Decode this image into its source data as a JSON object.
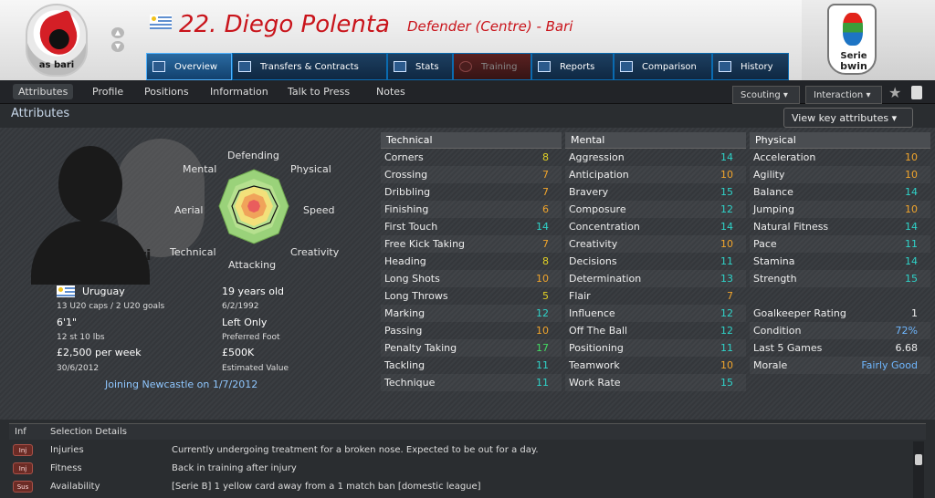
{
  "header": {
    "club_logo_text": "as bari",
    "player_name": "22. Diego Polenta",
    "position": "Defender (Centre) - Bari",
    "league_logo_l1": "Serie",
    "league_logo_l2": "bwin"
  },
  "tabs": [
    {
      "label": "Overview"
    },
    {
      "label": "Transfers & Contracts"
    },
    {
      "label": "Stats"
    },
    {
      "label": "Training"
    },
    {
      "label": "Reports"
    },
    {
      "label": "Comparison"
    },
    {
      "label": "History"
    }
  ],
  "subnav": {
    "items": [
      "Attributes",
      "Profile",
      "Positions",
      "Information",
      "Talk to Press",
      "Notes"
    ],
    "scouting": "Scouting",
    "interaction": "Interaction"
  },
  "section": {
    "title": "Attributes",
    "view_key": "View key attributes"
  },
  "radar_labels": {
    "defending": "Defending",
    "physical": "Physical",
    "speed": "Speed",
    "creativity": "Creativity",
    "attacking": "Attacking",
    "technical": "Technical",
    "aerial": "Aerial",
    "mental": "Mental"
  },
  "profile": {
    "nation": "Uruguay",
    "caps": "13 U20 caps / 2 U20 goals",
    "height": "6'1\"",
    "weight": "12 st 10 lbs",
    "wage": "£2,500 per week",
    "contract": "30/6/2012",
    "age": "19 years old",
    "dob": "6/2/1992",
    "foot": "Left Only",
    "foot_label": "Preferred Foot",
    "value": "£500K",
    "value_label": "Estimated Value",
    "joining": "Joining Newcastle on 1/7/2012"
  },
  "technical": {
    "title": "Technical",
    "rows": [
      {
        "name": "Corners",
        "val": "8",
        "c": "c-y"
      },
      {
        "name": "Crossing",
        "val": "7",
        "c": "c-o"
      },
      {
        "name": "Dribbling",
        "val": "7",
        "c": "c-o"
      },
      {
        "name": "Finishing",
        "val": "6",
        "c": "c-o"
      },
      {
        "name": "First Touch",
        "val": "14",
        "c": "c-t"
      },
      {
        "name": "Free Kick Taking",
        "val": "7",
        "c": "c-o"
      },
      {
        "name": "Heading",
        "val": "8",
        "c": "c-y"
      },
      {
        "name": "Long Shots",
        "val": "10",
        "c": "c-o"
      },
      {
        "name": "Long Throws",
        "val": "5",
        "c": "c-y"
      },
      {
        "name": "Marking",
        "val": "12",
        "c": "c-t"
      },
      {
        "name": "Passing",
        "val": "10",
        "c": "c-o"
      },
      {
        "name": "Penalty Taking",
        "val": "17",
        "c": "c-g"
      },
      {
        "name": "Tackling",
        "val": "11",
        "c": "c-t"
      },
      {
        "name": "Technique",
        "val": "11",
        "c": "c-t"
      }
    ]
  },
  "mental": {
    "title": "Mental",
    "rows": [
      {
        "name": "Aggression",
        "val": "14",
        "c": "c-t"
      },
      {
        "name": "Anticipation",
        "val": "10",
        "c": "c-o"
      },
      {
        "name": "Bravery",
        "val": "15",
        "c": "c-t"
      },
      {
        "name": "Composure",
        "val": "12",
        "c": "c-t"
      },
      {
        "name": "Concentration",
        "val": "14",
        "c": "c-t"
      },
      {
        "name": "Creativity",
        "val": "10",
        "c": "c-o"
      },
      {
        "name": "Decisions",
        "val": "11",
        "c": "c-t"
      },
      {
        "name": "Determination",
        "val": "13",
        "c": "c-t"
      },
      {
        "name": "Flair",
        "val": "7",
        "c": "c-o"
      },
      {
        "name": "Influence",
        "val": "12",
        "c": "c-t"
      },
      {
        "name": "Off The Ball",
        "val": "12",
        "c": "c-t"
      },
      {
        "name": "Positioning",
        "val": "11",
        "c": "c-t"
      },
      {
        "name": "Teamwork",
        "val": "10",
        "c": "c-o"
      },
      {
        "name": "Work Rate",
        "val": "15",
        "c": "c-t"
      }
    ]
  },
  "physical": {
    "title": "Physical",
    "rows": [
      {
        "name": "Acceleration",
        "val": "10",
        "c": "c-o"
      },
      {
        "name": "Agility",
        "val": "10",
        "c": "c-o"
      },
      {
        "name": "Balance",
        "val": "14",
        "c": "c-t"
      },
      {
        "name": "Jumping",
        "val": "10",
        "c": "c-o"
      },
      {
        "name": "Natural Fitness",
        "val": "14",
        "c": "c-t"
      },
      {
        "name": "Pace",
        "val": "11",
        "c": "c-t"
      },
      {
        "name": "Stamina",
        "val": "14",
        "c": "c-t"
      },
      {
        "name": "Strength",
        "val": "15",
        "c": "c-t"
      }
    ],
    "extra": [
      {
        "name": "Goalkeeper Rating",
        "val": "1",
        "c": ""
      },
      {
        "name": "Condition",
        "val": "72%",
        "c": "c-b"
      },
      {
        "name": "Last 5 Games",
        "val": "6.68",
        "c": ""
      },
      {
        "name": "Morale",
        "val": "Fairly Good",
        "c": "c-b"
      }
    ]
  },
  "selection": {
    "col1": "Inf",
    "col2": "Selection Details",
    "rows": [
      {
        "badge": "Inj",
        "key": "Injuries",
        "desc": "Currently undergoing treatment for a broken nose. Expected to be out for a day."
      },
      {
        "badge": "Inj",
        "key": "Fitness",
        "desc": "Back in training after injury"
      },
      {
        "badge": "Sus",
        "key": "Availability",
        "desc": "[Serie B] 1 yellow card away from a 1 match ban [domestic league]"
      }
    ]
  }
}
